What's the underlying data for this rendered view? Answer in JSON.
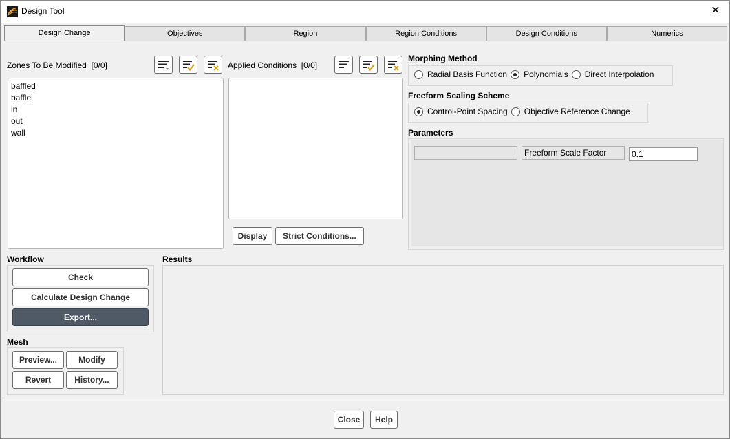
{
  "window": {
    "title": "Design Tool"
  },
  "tabs": [
    {
      "label": "Design Change",
      "active": true
    },
    {
      "label": "Objectives"
    },
    {
      "label": "Region"
    },
    {
      "label": "Region Conditions"
    },
    {
      "label": "Design Conditions"
    },
    {
      "label": "Numerics"
    }
  ],
  "zones": {
    "label": "Zones To Be Modified",
    "count": "[0/0]",
    "items": [
      "baffled",
      "bafflei",
      "in",
      "out",
      "wall"
    ]
  },
  "applied": {
    "label": "Applied Conditions",
    "count": "[0/0]",
    "display_label": "Display",
    "strict_label": "Strict Conditions..."
  },
  "morphing": {
    "label": "Morphing Method",
    "options": [
      "Radial Basis Function",
      "Polynomials",
      "Direct Interpolation"
    ],
    "selected": "Polynomials"
  },
  "scaling": {
    "label": "Freeform Scaling Scheme",
    "options": [
      "Control-Point Spacing",
      "Objective Reference Change"
    ],
    "selected": "Control-Point Spacing"
  },
  "parameters": {
    "label": "Parameters",
    "factor_label": "Freeform Scale Factor",
    "factor_value": "0.1"
  },
  "workflow": {
    "label": "Workflow",
    "check": "Check",
    "calculate": "Calculate Design Change",
    "export": "Export..."
  },
  "mesh": {
    "label": "Mesh",
    "preview": "Preview...",
    "modify": "Modify",
    "revert": "Revert",
    "history": "History..."
  },
  "results": {
    "label": "Results"
  },
  "footer": {
    "close": "Close",
    "help": "Help"
  },
  "colors": {
    "export_button": "#505a66",
    "background": "#f0f0f0"
  }
}
